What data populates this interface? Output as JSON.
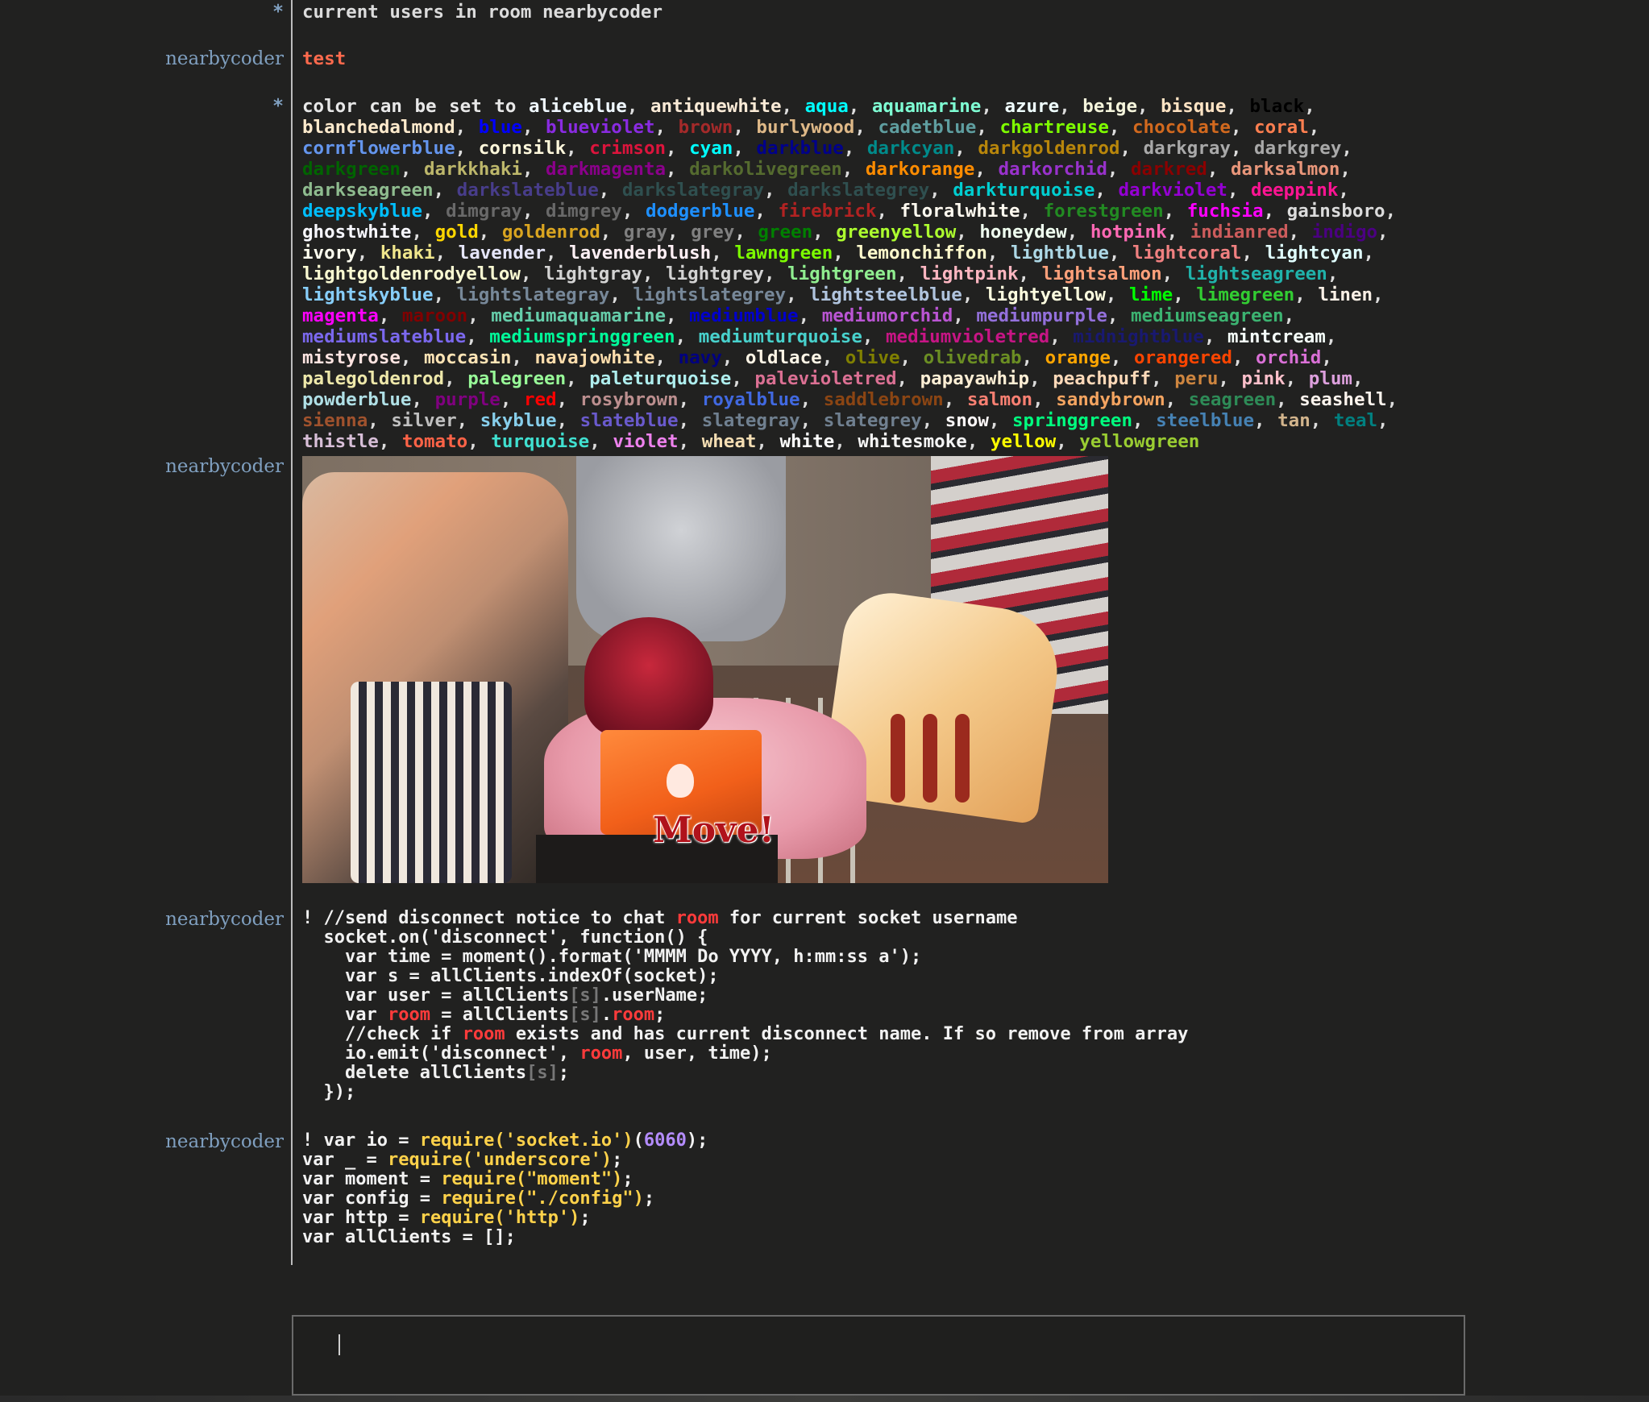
{
  "messages": {
    "m1": {
      "marker": "*",
      "text": "current users in room nearbycoder"
    },
    "m2": {
      "nick": "nearbycoder",
      "text": "test",
      "color": "#ff6a4d"
    },
    "m3": {
      "marker": "*",
      "prefix": "color can be set to",
      "colors": [
        "aliceblue",
        "antiquewhite",
        "aqua",
        "aquamarine",
        "azure",
        "beige",
        "bisque",
        "black",
        "blanchedalmond",
        "blue",
        "blueviolet",
        "brown",
        "burlywood",
        "cadetblue",
        "chartreuse",
        "chocolate",
        "coral",
        "cornflowerblue",
        "cornsilk",
        "crimson",
        "cyan",
        "darkblue",
        "darkcyan",
        "darkgoldenrod",
        "darkgray",
        "darkgrey",
        "darkgreen",
        "darkkhaki",
        "darkmagenta",
        "darkolivegreen",
        "darkorange",
        "darkorchid",
        "darkred",
        "darksalmon",
        "darkseagreen",
        "darkslateblue",
        "darkslategray",
        "darkslategrey",
        "darkturquoise",
        "darkviolet",
        "deeppink",
        "deepskyblue",
        "dimgray",
        "dimgrey",
        "dodgerblue",
        "firebrick",
        "floralwhite",
        "forestgreen",
        "fuchsia",
        "gainsboro",
        "ghostwhite",
        "gold",
        "goldenrod",
        "gray",
        "grey",
        "green",
        "greenyellow",
        "honeydew",
        "hotpink",
        "indianred",
        "indigo",
        "ivory",
        "khaki",
        "lavender",
        "lavenderblush",
        "lawngreen",
        "lemonchiffon",
        "lightblue",
        "lightcoral",
        "lightcyan",
        "lightgoldenrodyellow",
        "lightgray",
        "lightgrey",
        "lightgreen",
        "lightpink",
        "lightsalmon",
        "lightseagreen",
        "lightskyblue",
        "lightslategray",
        "lightslategrey",
        "lightsteelblue",
        "lightyellow",
        "lime",
        "limegreen",
        "linen",
        "magenta",
        "maroon",
        "mediumaquamarine",
        "mediumblue",
        "mediumorchid",
        "mediumpurple",
        "mediumseagreen",
        "mediumslateblue",
        "mediumspringgreen",
        "mediumturquoise",
        "mediumvioletred",
        "midnightblue",
        "mintcream",
        "mistyrose",
        "moccasin",
        "navajowhite",
        "navy",
        "oldlace",
        "olive",
        "olivedrab",
        "orange",
        "orangered",
        "orchid",
        "palegoldenrod",
        "palegreen",
        "paleturquoise",
        "palevioletred",
        "papayawhip",
        "peachpuff",
        "peru",
        "pink",
        "plum",
        "powderblue",
        "purple",
        "red",
        "rosybrown",
        "royalblue",
        "saddlebrown",
        "salmon",
        "sandybrown",
        "seagreen",
        "seashell",
        "sienna",
        "silver",
        "skyblue",
        "slateblue",
        "slategray",
        "slategrey",
        "snow",
        "springgreen",
        "steelblue",
        "tan",
        "teal",
        "thistle",
        "tomato",
        "turquoise",
        "violet",
        "wheat",
        "white",
        "whitesmoke",
        "yellow",
        "yellowgreen"
      ]
    },
    "m4": {
      "nick": "nearbycoder",
      "image_caption": "Move!"
    },
    "m5": {
      "nick": "nearbycoder",
      "lines": [
        [
          [
            "! //send disconnect notice to chat ",
            ""
          ],
          [
            "room",
            "room"
          ],
          [
            " for current socket username",
            ""
          ]
        ],
        [
          [
            "  socket.on('disconnect', function() {",
            ""
          ]
        ],
        [
          [
            "    var time = moment().format('MMMM Do YYYY, h:mm:ss a');",
            ""
          ]
        ],
        [
          [
            "    var s = allClients.indexOf(socket);",
            ""
          ]
        ],
        [
          [
            "    var user = allClients",
            ""
          ],
          [
            "[s]",
            "dim"
          ],
          [
            ".userName;",
            ""
          ]
        ],
        [
          [
            "    var ",
            ""
          ],
          [
            "room",
            "room"
          ],
          [
            " = allClients",
            ""
          ],
          [
            "[s]",
            "dim"
          ],
          [
            ".",
            ""
          ],
          [
            "room",
            "room"
          ],
          [
            ";",
            ""
          ]
        ],
        [
          [
            "    //check if ",
            ""
          ],
          [
            "room",
            "room"
          ],
          [
            " exists and has current disconnect name. If so remove from array",
            ""
          ]
        ],
        [
          [
            "    io.emit('disconnect', ",
            ""
          ],
          [
            "room",
            "room"
          ],
          [
            ", user, time);",
            ""
          ]
        ],
        [
          [
            "    delete allClients",
            ""
          ],
          [
            "[s]",
            "dim"
          ],
          [
            ";",
            ""
          ]
        ],
        [
          [
            "  });",
            ""
          ]
        ]
      ]
    },
    "m6": {
      "nick": "nearbycoder",
      "lines": [
        [
          [
            "! var io = ",
            ""
          ],
          [
            "require",
            "req"
          ],
          [
            "('socket.io')",
            "str"
          ],
          [
            "(",
            ""
          ],
          [
            "6060",
            "num"
          ],
          [
            ");",
            ""
          ]
        ],
        [
          [
            "var _ = ",
            ""
          ],
          [
            "require",
            "req"
          ],
          [
            "('underscore')",
            "str"
          ],
          [
            ";",
            ""
          ]
        ],
        [
          [
            "var moment = ",
            ""
          ],
          [
            "require",
            "req"
          ],
          [
            "(\"moment\")",
            "str"
          ],
          [
            ";",
            ""
          ]
        ],
        [
          [
            "var config = ",
            ""
          ],
          [
            "require",
            "req"
          ],
          [
            "(\"./config\")",
            "str"
          ],
          [
            ";",
            ""
          ]
        ],
        [
          [
            "var http = ",
            ""
          ],
          [
            "require",
            "req"
          ],
          [
            "('http')",
            "str"
          ],
          [
            ";",
            ""
          ]
        ],
        [
          [
            "var allClients = [];",
            ""
          ]
        ]
      ]
    }
  },
  "composer": {
    "value": "",
    "placeholder": ""
  },
  "colors": {
    "background": "#212120",
    "nick": "#7f9fbf",
    "room_keyword": "#ff3b3b",
    "string": "#ffd24a",
    "number": "#b48cff"
  }
}
